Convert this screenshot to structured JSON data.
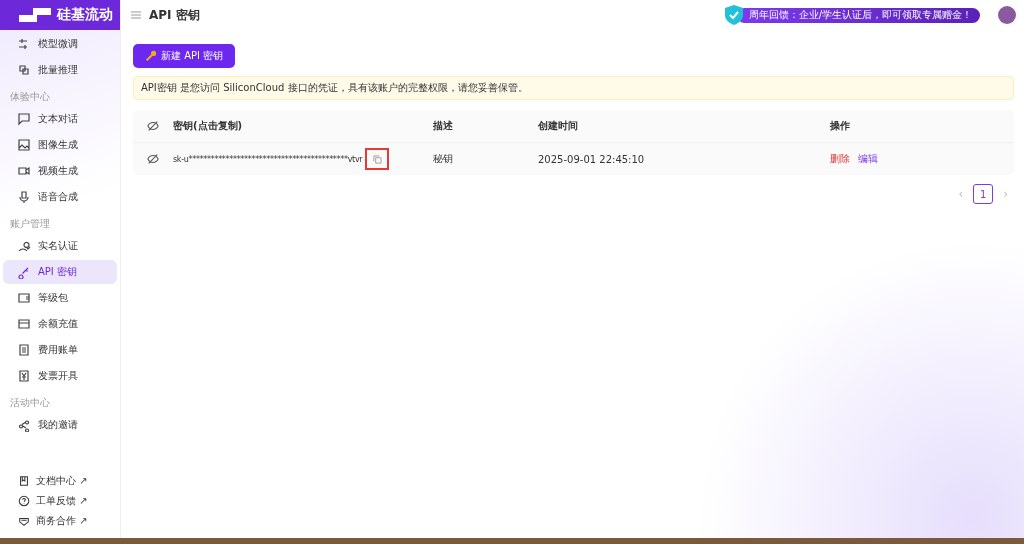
{
  "brand": {
    "name": "硅基流动"
  },
  "header": {
    "title": "API 密钥",
    "banner": "周年回馈：企业/学生认证后，即可领取专属赠金！"
  },
  "sidebar": {
    "groups": [
      {
        "items": [
          {
            "label": "模型微调",
            "selected": false
          },
          {
            "label": "批量推理",
            "selected": false
          }
        ]
      },
      {
        "label": "体验中心",
        "items": [
          {
            "label": "文本对话",
            "selected": false
          },
          {
            "label": "图像生成",
            "selected": false
          },
          {
            "label": "视频生成",
            "selected": false
          },
          {
            "label": "语音合成",
            "selected": false
          }
        ]
      },
      {
        "label": "账户管理",
        "items": [
          {
            "label": "实名认证",
            "selected": false
          },
          {
            "label": "API 密钥",
            "selected": true
          },
          {
            "label": "等级包",
            "selected": false
          },
          {
            "label": "余额充值",
            "selected": false
          },
          {
            "label": "费用账单",
            "selected": false
          },
          {
            "label": "发票开具",
            "selected": false
          }
        ]
      },
      {
        "label": "活动中心",
        "items": [
          {
            "label": "我的邀请",
            "selected": false
          }
        ]
      }
    ],
    "links": [
      "文档中心 ↗",
      "工单反馈 ↗",
      "商务合作 ↗"
    ]
  },
  "new_button": "新建 API 密钥",
  "notice": "API密钥 是您访问 SiliconCloud 接口的凭证，具有该账户的完整权限，请您妥善保管。",
  "table": {
    "columns": [
      "密钥(点击复制)",
      "描述",
      "创建时间",
      "操作"
    ],
    "rows": [
      {
        "key": "sk-u*******************************************vtvr",
        "copy_highlighted": true,
        "description": "秘钥",
        "created": "2025-09-01 22:45:10",
        "actions": [
          {
            "label": "删除",
            "kind": "danger"
          },
          {
            "label": "编辑",
            "kind": "primary"
          }
        ]
      }
    ]
  },
  "pagination": {
    "previous": "‹",
    "pages": [
      {
        "label": "1",
        "selected": true
      }
    ],
    "next": "›"
  }
}
